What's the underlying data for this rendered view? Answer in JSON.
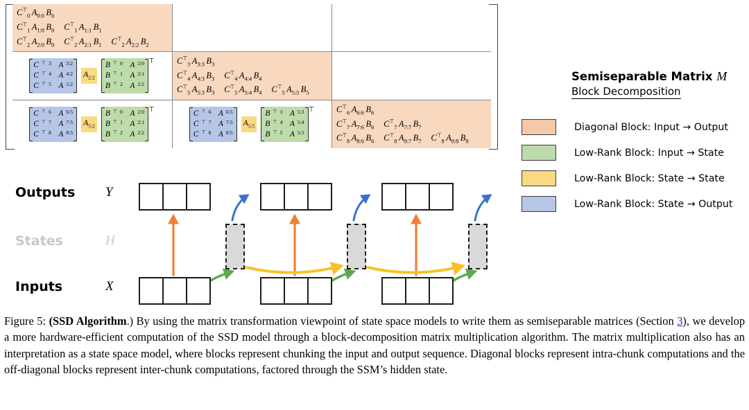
{
  "matrix": {
    "diagonal_blocks": [
      {
        "id": "block-0-0",
        "rows": [
          [
            "C0^T A0:0 B0"
          ],
          [
            "C1^T A1:0 B0",
            "C1^T A1:1 B1"
          ],
          [
            "C2^T A2:0 B0",
            "C2^T A2:1 B1",
            "C2^T A2:2 B2"
          ]
        ]
      },
      {
        "id": "block-1-1",
        "rows": [
          [
            "C3^T A3:3 B3"
          ],
          [
            "C4^T A4:3 B3",
            "C4^T A4:4 B4"
          ],
          [
            "C5^T A5:3 B3",
            "C5^T A5:4 B4",
            "C5^T A5:5 B5"
          ]
        ]
      },
      {
        "id": "block-2-2",
        "rows": [
          [
            "C6^T A6:6 B6"
          ],
          [
            "C7^T A7:6 B6",
            "C7^T A7:7 B7"
          ],
          [
            "C8^T A8:6 B6",
            "C8^T A8:7 B7",
            "C8^T A8:8 B8"
          ]
        ]
      }
    ],
    "lowrank_blocks": [
      {
        "id": "block-1-0",
        "C": [
          "C3^T A3:2",
          "C4^T A4:2",
          "C5^T A5:2"
        ],
        "A": "A2:2",
        "B": [
          "B0^T A2:0",
          "B1^T A2:1",
          "B2^T A2:2"
        ],
        "transpose": "T"
      },
      {
        "id": "block-2-0",
        "C": [
          "C6^T A6:5",
          "C7^T A7:5",
          "C8^T A8:5"
        ],
        "A": "A5:2",
        "B": [
          "B0^T A2:0",
          "B1^T A2:1",
          "B2^T A2:2"
        ],
        "transpose": "T"
      },
      {
        "id": "block-2-1",
        "C": [
          "C6^T A6:5",
          "C7^T A7:5",
          "C8^T A8:5"
        ],
        "A": "A5:5",
        "B": [
          "B3^T A5:3",
          "B4^T A5:4",
          "B5^T A5:5"
        ],
        "transpose": "T"
      }
    ]
  },
  "legend": {
    "title_text": "Semiseparable Matrix",
    "title_symbol": "M",
    "subtitle": "Block Decomposition",
    "entries": [
      {
        "label": "Diagonal Block: Input → Output",
        "color": "#f6c9a8"
      },
      {
        "label": "Low-Rank Block: Input → State",
        "color": "#bedbab"
      },
      {
        "label": "Low-Rank Block: State → State",
        "color": "#fbd982"
      },
      {
        "label": "Low-Rank Block: State → Output",
        "color": "#b6c6e6"
      }
    ]
  },
  "diagram": {
    "rows": [
      {
        "label": "Outputs",
        "symbol": "Y",
        "muted": false
      },
      {
        "label": "States",
        "symbol": "H",
        "muted": true
      },
      {
        "label": "Inputs",
        "symbol": "X",
        "muted": false
      }
    ],
    "cells_per_chunk": 3,
    "chunk_count": 3,
    "state_count": 3,
    "arrow_colors": {
      "diagonal": "#ef7f38",
      "input_to_state": "#5da94e",
      "state_to_state": "#f5c327",
      "state_to_output": "#3c6fd0"
    }
  },
  "caption": {
    "figure_label": "Figure 5:",
    "bold_title": "(SSD Algorithm",
    "bold_tail": ".)",
    "part1": " By using the matrix transformation viewpoint of state space models to write them as semiseparable matrices (Section ",
    "link": "3",
    "part2": "), we develop a more hardware-efficient computation of the SSD model through a block-decomposition matrix multiplication algorithm. The matrix multiplication also has an interpretation as a state space model, where blocks represent chunking the input and output sequence. Diagonal blocks represent intra-chunk computations and the off-diagonal blocks represent inter-chunk computations, factored through the SSM’s hidden state."
  }
}
